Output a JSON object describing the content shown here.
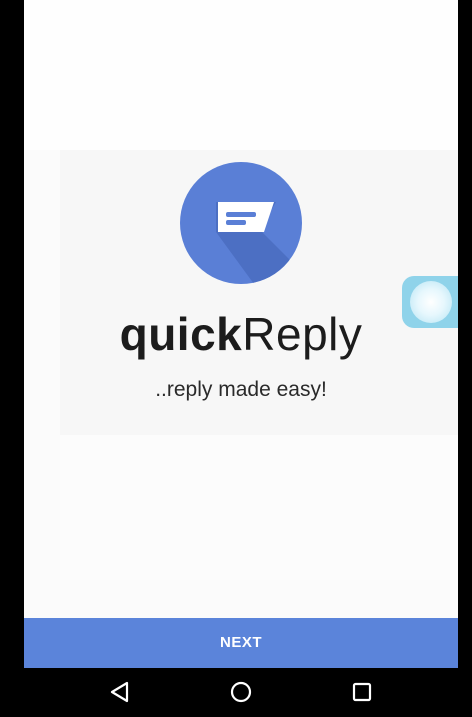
{
  "app": {
    "name_bold": "quick",
    "name_light": "Reply",
    "tagline": "..reply made easy!",
    "logo_icon": "chat-bubble-icon",
    "brand_color": "#5a7fd6"
  },
  "overlay": {
    "icon": "floating-bubble-icon",
    "color": "#8fd3ea"
  },
  "actions": {
    "next_label": "NEXT",
    "next_color": "#5b84da"
  },
  "navigation": {
    "back_icon": "back-triangle-icon",
    "home_icon": "home-circle-icon",
    "recents_icon": "recents-square-icon"
  }
}
